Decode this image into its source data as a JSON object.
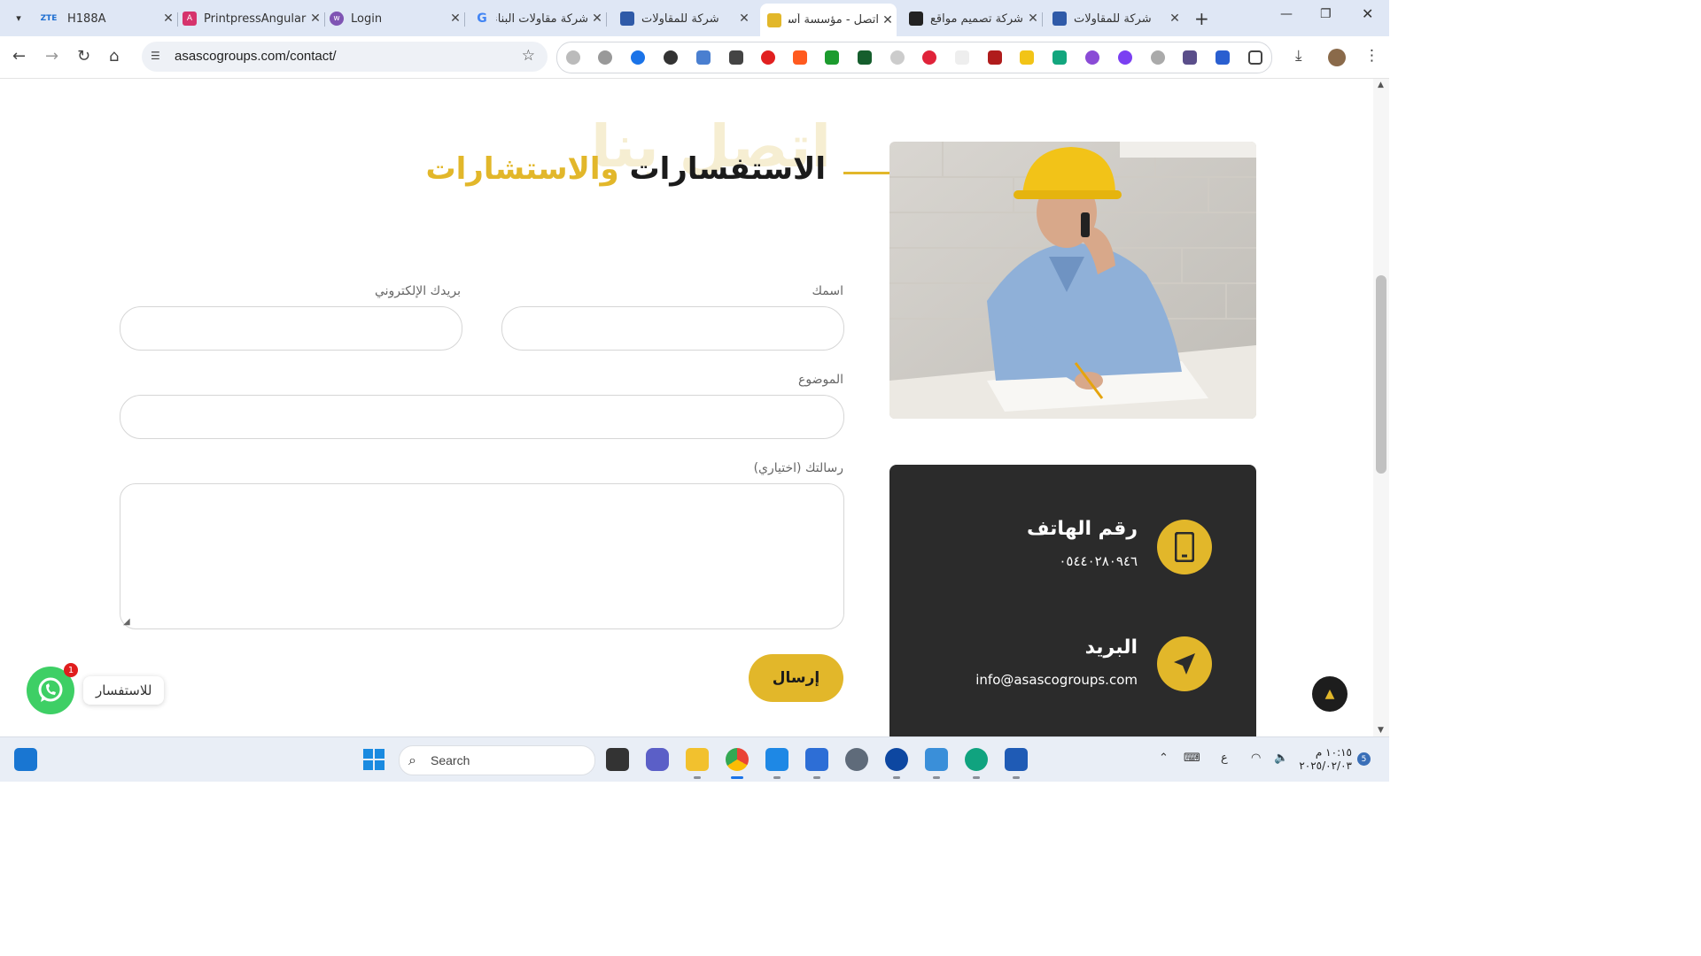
{
  "browser": {
    "tabs": [
      {
        "title": "H188A",
        "favicon": "ZTE",
        "color": "#1f6fd1"
      },
      {
        "title": "PrintpressAngular",
        "favicon": "angular-icon",
        "color": "#d6336c"
      },
      {
        "title": "Login",
        "favicon": "woo-icon",
        "color": "#7f54b3"
      },
      {
        "title": "شركة مقاولات البناء",
        "favicon": "google-icon",
        "color": "#4285f4"
      },
      {
        "title": "شركة للمقاولات",
        "favicon": "site-icon",
        "color": "#2f5aa8"
      },
      {
        "title": "اتصل - مؤسسة أساس",
        "favicon": "site-icon",
        "color": "#e2b72a",
        "active": true
      },
      {
        "title": "شركة تصميم مواقع",
        "favicon": "site-icon",
        "color": "#222222"
      },
      {
        "title": "شركة للمقاولات",
        "favicon": "site-icon",
        "color": "#2f5aa8"
      }
    ],
    "url": "asascogroups.com/contact/"
  },
  "page": {
    "watermark": "اتصل بنا",
    "heading_dark": "الاستفسارات",
    "heading_gold": "والاستشارات",
    "form": {
      "name_label": "اسمك",
      "email_label": "بريدك الإلكتروني",
      "subject_label": "الموضوع",
      "message_label": "رسالتك (اختياري)",
      "submit_label": "إرسال"
    },
    "contact": {
      "phone_title": "رقم الهاتف",
      "phone_value": "٠٥٤٤٠٢٨٠٩٤٦",
      "email_title": "البريد",
      "email_value": "info@asascogroups.com"
    },
    "whatsapp": {
      "label": "للاستفسار",
      "badge": "1"
    },
    "colors": {
      "accent": "#e2b72a",
      "dark": "#2b2b2b"
    }
  },
  "taskbar": {
    "search_placeholder": "Search",
    "lang": "ع",
    "time": "١٠:١٥ م",
    "date": "٢٠٢٥/٠٢/٠٣",
    "notification_count": "5"
  }
}
